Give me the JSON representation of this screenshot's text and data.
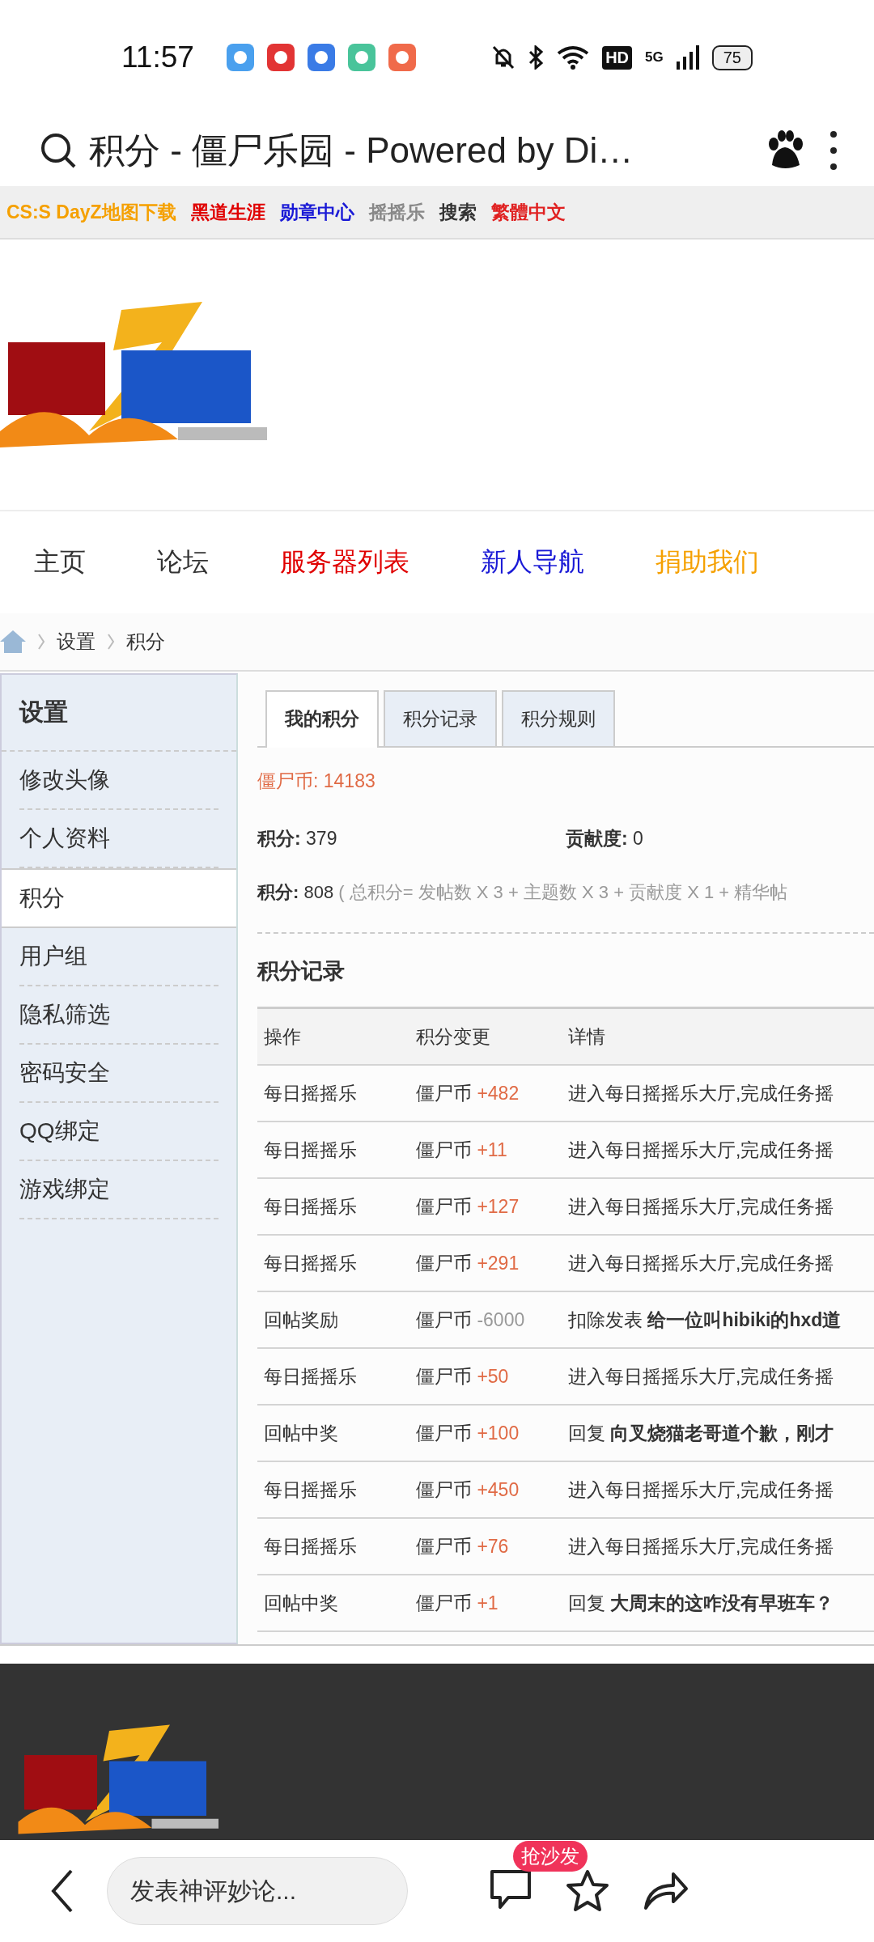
{
  "status_bar": {
    "time": "11:57",
    "network": "5G",
    "hd": "HD",
    "battery": "75"
  },
  "browser_bar": {
    "title": "积分 - 僵尸乐园 - Powered by Di…"
  },
  "top_links": [
    {
      "label": "CS:S DayZ地图下载",
      "color": "#f5a000"
    },
    {
      "label": "黑道生涯",
      "color": "#e00000"
    },
    {
      "label": "勋章中心",
      "color": "#1a1ad6"
    },
    {
      "label": "摇摇乐",
      "color": "#888888"
    },
    {
      "label": "搜索",
      "color": "#333333"
    },
    {
      "label": "繁體中文",
      "color": "#e02020"
    }
  ],
  "nav": [
    {
      "label": "主页",
      "color": "#333333"
    },
    {
      "label": "论坛",
      "color": "#333333"
    },
    {
      "label": "服务器列表",
      "color": "#e00000"
    },
    {
      "label": "新人导航",
      "color": "#1a1ad6"
    },
    {
      "label": "捐助我们",
      "color": "#f5a000"
    }
  ],
  "breadcrumb": [
    "设置",
    "积分"
  ],
  "sidebar": {
    "title": "设置",
    "items": [
      {
        "label": "修改头像",
        "selected": false
      },
      {
        "label": "个人资料",
        "selected": false
      },
      {
        "label": "积分",
        "selected": true
      },
      {
        "label": "用户组",
        "selected": false
      },
      {
        "label": "隐私筛选",
        "selected": false
      },
      {
        "label": "密码安全",
        "selected": false
      },
      {
        "label": "QQ绑定",
        "selected": false
      },
      {
        "label": "游戏绑定",
        "selected": false
      }
    ]
  },
  "tabs": [
    {
      "label": "我的积分",
      "selected": true
    },
    {
      "label": "积分记录",
      "selected": false
    },
    {
      "label": "积分规则",
      "selected": false
    }
  ],
  "coins": {
    "label": "僵尸币:",
    "value": "14183"
  },
  "stats": [
    {
      "label": "积分:",
      "value": "379"
    },
    {
      "label": "贡献度:",
      "value": "0"
    }
  ],
  "total": {
    "label": "积分:",
    "value": "808",
    "formula": "( 总积分= 发帖数 X 3 + 主题数 X 3 + 贡献度 X 1 + 精华帖"
  },
  "records": {
    "title": "积分记录",
    "columns": [
      "操作",
      "积分变更",
      "详情"
    ],
    "rows": [
      {
        "action": "每日摇摇乐",
        "currency": "僵尸币",
        "change": "+482",
        "kind": "gain",
        "detail": "进入每日摇摇乐大厅,完成任务摇"
      },
      {
        "action": "每日摇摇乐",
        "currency": "僵尸币",
        "change": "+11",
        "kind": "gain",
        "detail": "进入每日摇摇乐大厅,完成任务摇"
      },
      {
        "action": "每日摇摇乐",
        "currency": "僵尸币",
        "change": "+127",
        "kind": "gain",
        "detail": "进入每日摇摇乐大厅,完成任务摇"
      },
      {
        "action": "每日摇摇乐",
        "currency": "僵尸币",
        "change": "+291",
        "kind": "gain",
        "detail": "进入每日摇摇乐大厅,完成任务摇"
      },
      {
        "action": "回帖奖励",
        "currency": "僵尸币",
        "change": "-6000",
        "kind": "loss",
        "detail": "扣除发表 **给一位叫hibiki的hxd道**"
      },
      {
        "action": "每日摇摇乐",
        "currency": "僵尸币",
        "change": "+50",
        "kind": "gain",
        "detail": "进入每日摇摇乐大厅,完成任务摇"
      },
      {
        "action": "回帖中奖",
        "currency": "僵尸币",
        "change": "+100",
        "kind": "gain",
        "detail": "回复 **向叉烧猫老哥道个歉，刚才**"
      },
      {
        "action": "每日摇摇乐",
        "currency": "僵尸币",
        "change": "+450",
        "kind": "gain",
        "detail": "进入每日摇摇乐大厅,完成任务摇"
      },
      {
        "action": "每日摇摇乐",
        "currency": "僵尸币",
        "change": "+76",
        "kind": "gain",
        "detail": "进入每日摇摇乐大厅,完成任务摇"
      },
      {
        "action": "回帖中奖",
        "currency": "僵尸币",
        "change": "+1",
        "kind": "gain",
        "detail": "回复 **大周末的这咋没有早班车？**"
      }
    ]
  },
  "bottom_bar": {
    "comment_placeholder": "发表神评妙论...",
    "badge": "抢沙发"
  }
}
